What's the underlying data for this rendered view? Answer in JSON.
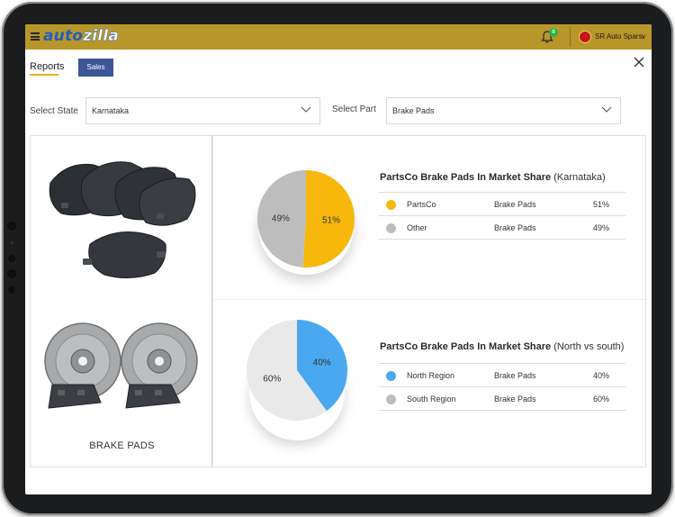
{
  "header": {
    "logo_part1": "auto",
    "logo_part2": "zilla",
    "notification_count": "0",
    "user_name": "SR Auto Spars",
    "user_caret": "∨"
  },
  "tabs": [
    {
      "label": "Reports"
    },
    {
      "label": "Sales"
    }
  ],
  "filters": {
    "state_label": "Select State",
    "state_value": "Karnataka",
    "part_label": "Select Part",
    "part_value": "Brake Pads"
  },
  "product": {
    "label": "BRAKE PADS"
  },
  "colors": {
    "accent": "#e2b519",
    "yellow": "#f7b70b",
    "grey": "#bdbdbd",
    "blue": "#4aa8f0",
    "light": "#e9e9e9",
    "topbar": "#b8962a",
    "tab": "#3e5597"
  },
  "cards": [
    {
      "title_bold": "PartsCo Brake Pads In Market Share",
      "title_rest": "(Karnataka)",
      "rows": [
        {
          "name": "PartsCo",
          "part": "Brake Pads",
          "share": "51%"
        },
        {
          "name": "Other",
          "part": "Brake Pads",
          "share": "49%"
        }
      ]
    },
    {
      "title_bold": "PartsCo Brake Pads In Market Share",
      "title_rest": "(North vs south)",
      "rows": [
        {
          "name": "North Region",
          "part": "Brake Pads",
          "share": "40%"
        },
        {
          "name": "South Region",
          "part": "Brake Pads",
          "share": "60%"
        }
      ]
    }
  ],
  "chart_data": [
    {
      "type": "pie",
      "categories": [
        "PartsCo",
        "Other"
      ],
      "values": [
        51,
        49
      ],
      "labels": [
        "51%",
        "49%"
      ],
      "colors": [
        "#f7b70b",
        "#bdbdbd"
      ]
    },
    {
      "type": "pie",
      "categories": [
        "North Region",
        "South Region"
      ],
      "values": [
        40,
        60
      ],
      "labels": [
        "40%",
        "60%"
      ],
      "colors": [
        "#4aa8f0",
        "#e9e9e9"
      ]
    }
  ]
}
